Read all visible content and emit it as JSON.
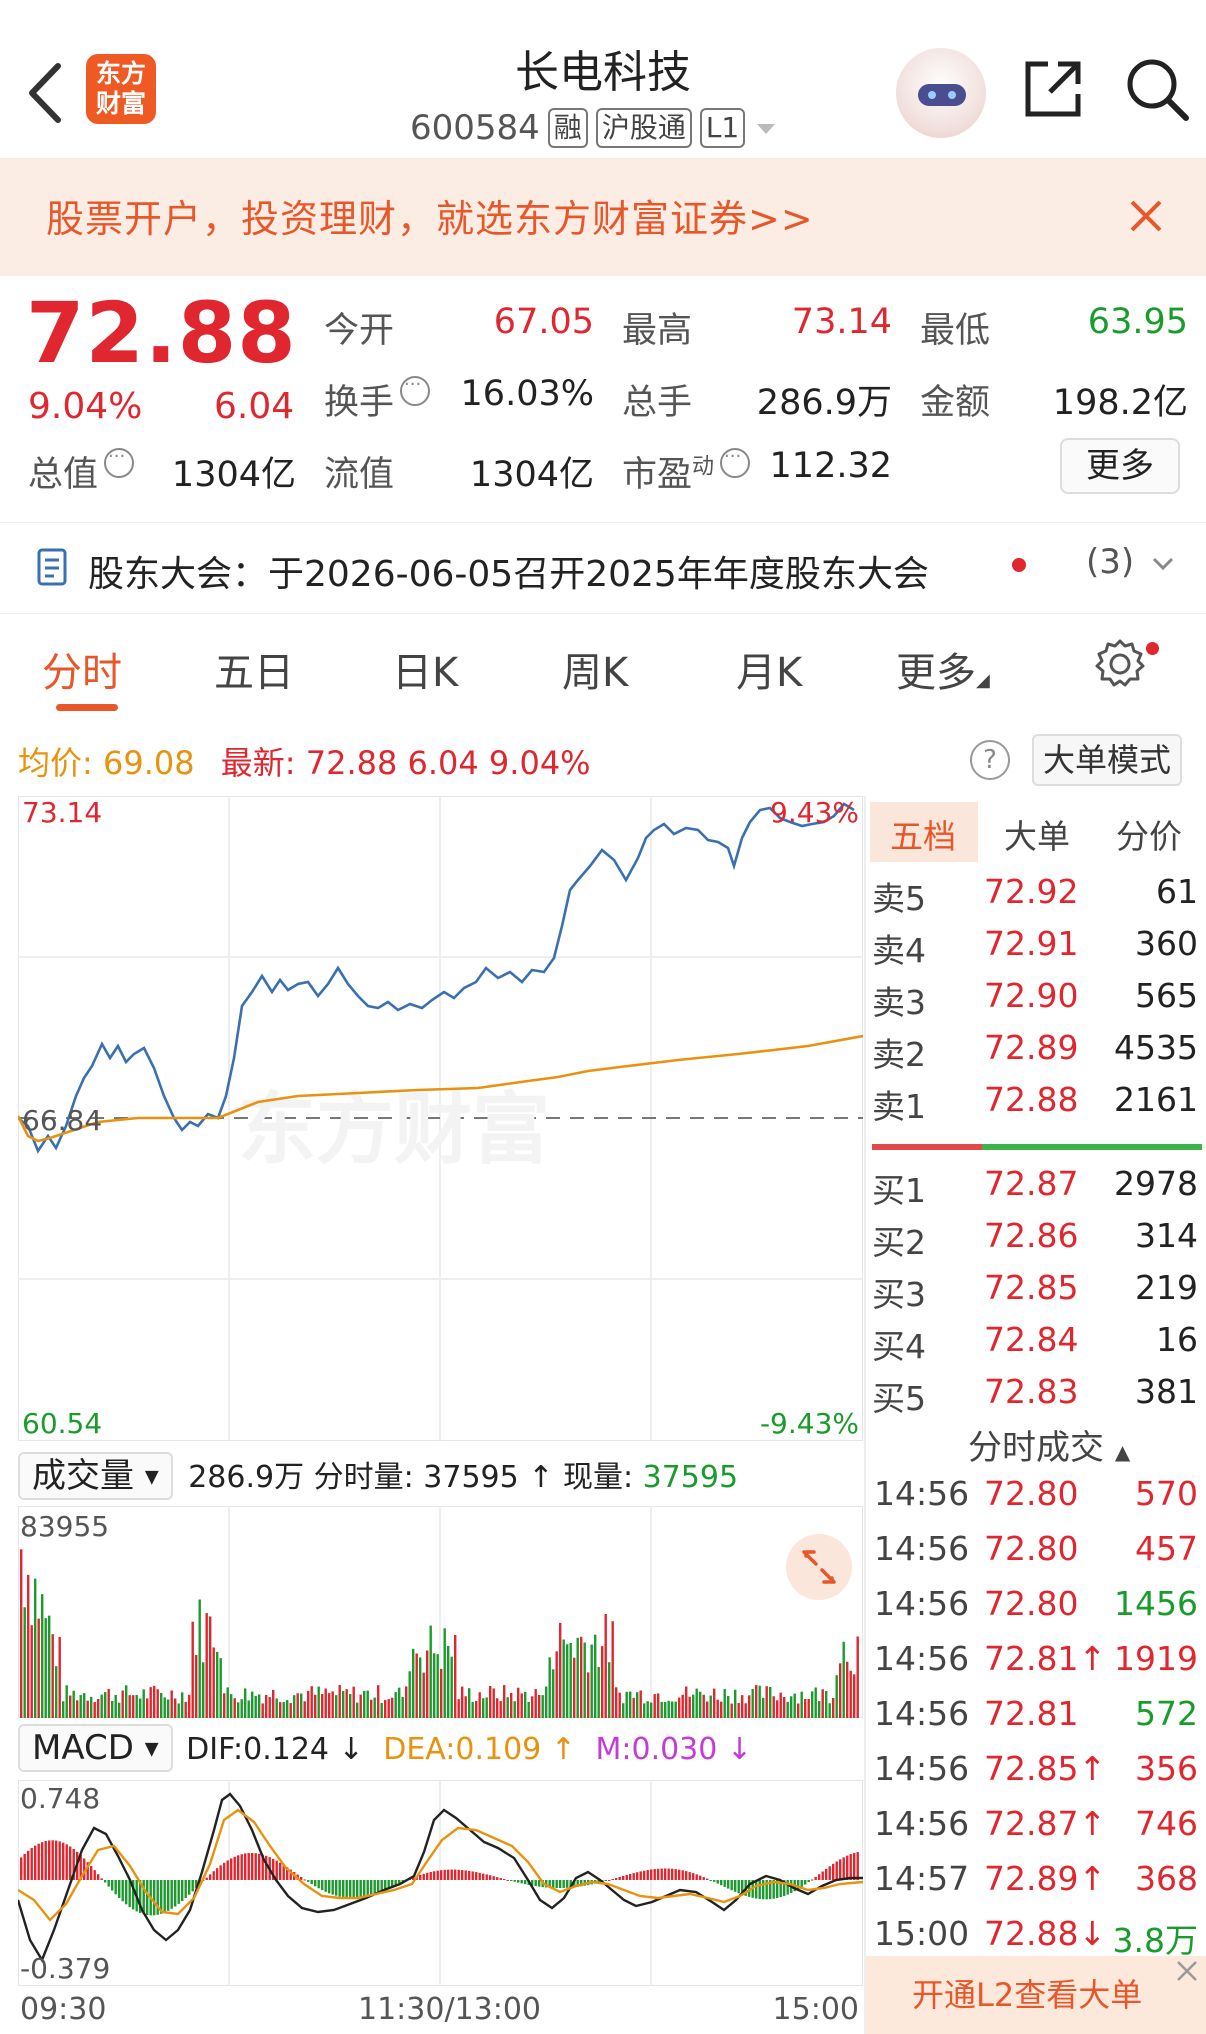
{
  "header": {
    "logo_line1": "东方",
    "logo_line2": "财富",
    "title": "长电科技",
    "code": "600584",
    "tags": [
      "融",
      "沪股通",
      "L1"
    ]
  },
  "promo": {
    "text": "股票开户，投资理财，就选东方财富证券>>"
  },
  "quote": {
    "price": "72.88",
    "change_pct": "9.04%",
    "change": "6.04",
    "open_label": "今开",
    "open": "67.05",
    "high_label": "最高",
    "high": "73.14",
    "low_label": "最低",
    "low": "63.95",
    "turnover_label": "换手",
    "turnover": "16.03%",
    "volume_label": "总手",
    "volume": "286.9万",
    "amount_label": "金额",
    "amount": "198.2亿",
    "mktcap_label": "总值",
    "mktcap": "1304亿",
    "float_label": "流值",
    "float_cap": "1304亿",
    "pe_label": "市盈",
    "pe_sup": "动",
    "pe": "112.32",
    "more": "更多"
  },
  "notice": {
    "text": "股东大会：于2026-06-05召开2025年年度股东大会",
    "count": "(3)"
  },
  "tabs": [
    "分时",
    "五日",
    "日K",
    "周K",
    "月K",
    "更多"
  ],
  "avg_row": {
    "avg_label": "均价:",
    "avg": "69.08",
    "latest_label": "最新:",
    "latest": "72.88",
    "latest_chg": "6.04",
    "latest_pct": "9.04%",
    "big_order_mode": "大单模式"
  },
  "price_chart": {
    "top_price": "73.14",
    "top_pct": "9.43%",
    "mid_price": "66.84",
    "bottom_price": "60.54",
    "bottom_pct": "-9.43%",
    "watermark": "东方财富"
  },
  "volume": {
    "dropdown": "成交量",
    "total": "286.9万",
    "minute_label": "分时量:",
    "minute": "37595 ↑",
    "now_label": "现量:",
    "now": "37595",
    "max_label": "83955"
  },
  "macd": {
    "dropdown": "MACD",
    "dif": "DIF:0.124 ↓",
    "dea": "DEA:0.109 ↑",
    "m": "M:0.030 ↓",
    "top": "0.748",
    "bottom": "-0.379"
  },
  "time_axis": [
    "09:30",
    "11:30/13:00",
    "15:00"
  ],
  "book_tabs": [
    "五档",
    "大单",
    "分价"
  ],
  "asks": [
    {
      "n": "卖5",
      "p": "72.92",
      "q": "61"
    },
    {
      "n": "卖4",
      "p": "72.91",
      "q": "360"
    },
    {
      "n": "卖3",
      "p": "72.90",
      "q": "565"
    },
    {
      "n": "卖2",
      "p": "72.89",
      "q": "4535"
    },
    {
      "n": "卖1",
      "p": "72.88",
      "q": "2161"
    }
  ],
  "bids": [
    {
      "n": "买1",
      "p": "72.87",
      "q": "2978"
    },
    {
      "n": "买2",
      "p": "72.86",
      "q": "314"
    },
    {
      "n": "买3",
      "p": "72.85",
      "q": "219"
    },
    {
      "n": "买4",
      "p": "72.84",
      "q": "16"
    },
    {
      "n": "买5",
      "p": "72.83",
      "q": "381"
    }
  ],
  "ticks_head": "分时成交",
  "ticks": [
    {
      "t": "14:56",
      "p": "72.80",
      "q": "570",
      "qc": "red"
    },
    {
      "t": "14:56",
      "p": "72.80",
      "q": "457",
      "qc": "red"
    },
    {
      "t": "14:56",
      "p": "72.80",
      "q": "1456",
      "qc": "green"
    },
    {
      "t": "14:56",
      "p": "72.81↑",
      "q": "1919",
      "qc": "red"
    },
    {
      "t": "14:56",
      "p": "72.81",
      "q": "572",
      "qc": "green"
    },
    {
      "t": "14:56",
      "p": "72.85↑",
      "q": "356",
      "qc": "red"
    },
    {
      "t": "14:56",
      "p": "72.87↑",
      "q": "746",
      "qc": "red"
    },
    {
      "t": "14:57",
      "p": "72.89↑",
      "q": "368",
      "qc": "red"
    },
    {
      "t": "15:00",
      "p": "72.88↓",
      "q": "3.8万",
      "qc": "green"
    }
  ],
  "l2_banner": "开通L2查看大单",
  "colors": {
    "up": "#e0262e",
    "down": "#1a9c2d",
    "brand": "#e8572a",
    "price_line": "#3a6fb0",
    "avg_line": "#e8920f"
  }
}
